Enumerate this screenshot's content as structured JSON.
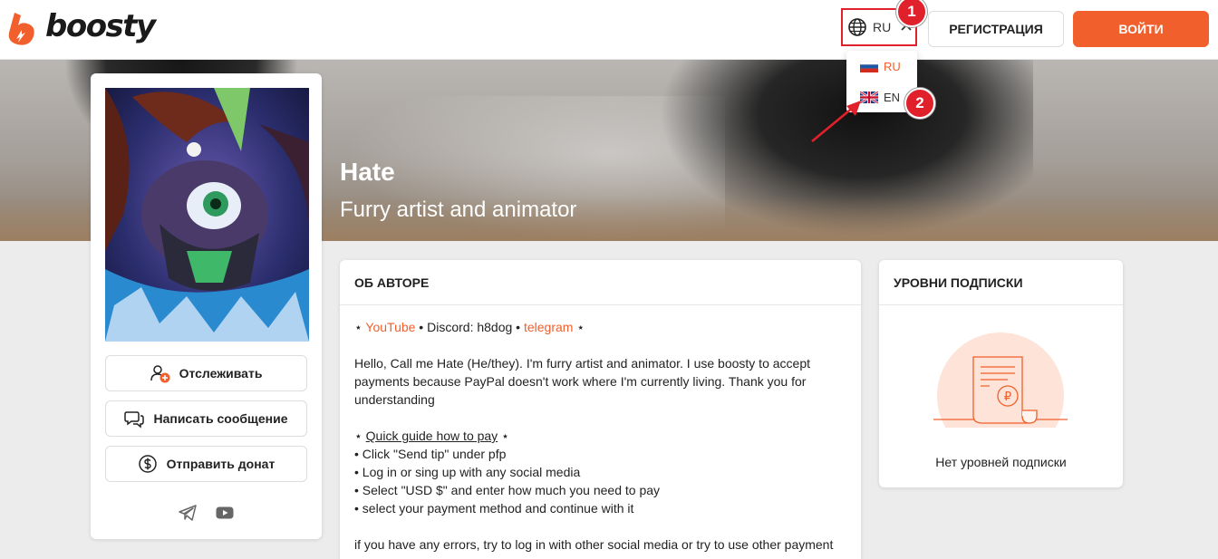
{
  "header": {
    "logo_text": "boosty",
    "lang_code": "RU",
    "register_label": "РЕГИСТРАЦИЯ",
    "login_label": "ВОЙТИ"
  },
  "lang_menu": {
    "items": [
      {
        "code": "RU",
        "flag": "russia-flag-icon",
        "active": true
      },
      {
        "code": "EN",
        "flag": "uk-flag-icon",
        "active": false
      }
    ]
  },
  "annotations": {
    "marker1": "1",
    "marker2": "2"
  },
  "cover": {
    "title": "Hate",
    "subtitle": "Furry artist and animator"
  },
  "profile": {
    "follow_label": "Отслеживать",
    "message_label": "Написать сообщение",
    "donate_label": "Отправить донат",
    "social_icons": [
      "telegram-icon",
      "youtube-icon"
    ]
  },
  "about": {
    "heading": "ОБ АВТОРЕ",
    "star": "⋆",
    "youtube_link": "YouTube",
    "bullet_sep": " • ",
    "discord_text": "Discord: h8dog",
    "telegram_link": "telegram",
    "intro": "Hello, Call me Hate (He/they). I'm furry artist and animator. I use boosty to accept payments because PayPal doesn't work where I'm currently living. Thank you for understanding",
    "guide_link": "Quick guide how to pay",
    "steps": [
      "• Click \"Send tip\" under pfp",
      "• Log in or sing up with any social media",
      "• Select \"USD $\" and enter how much you need to pay",
      "• select your payment method and continue with it"
    ],
    "errors_text": "if you have any errors, try to log in with other social media or try to use other payment"
  },
  "levels": {
    "heading": "УРОВНИ ПОДПИСКИ",
    "empty_text": "Нет уровней подписки",
    "currency_symbol": "₽"
  },
  "colors": {
    "accent": "#f15f2c",
    "annotation_red": "#e0202a"
  }
}
